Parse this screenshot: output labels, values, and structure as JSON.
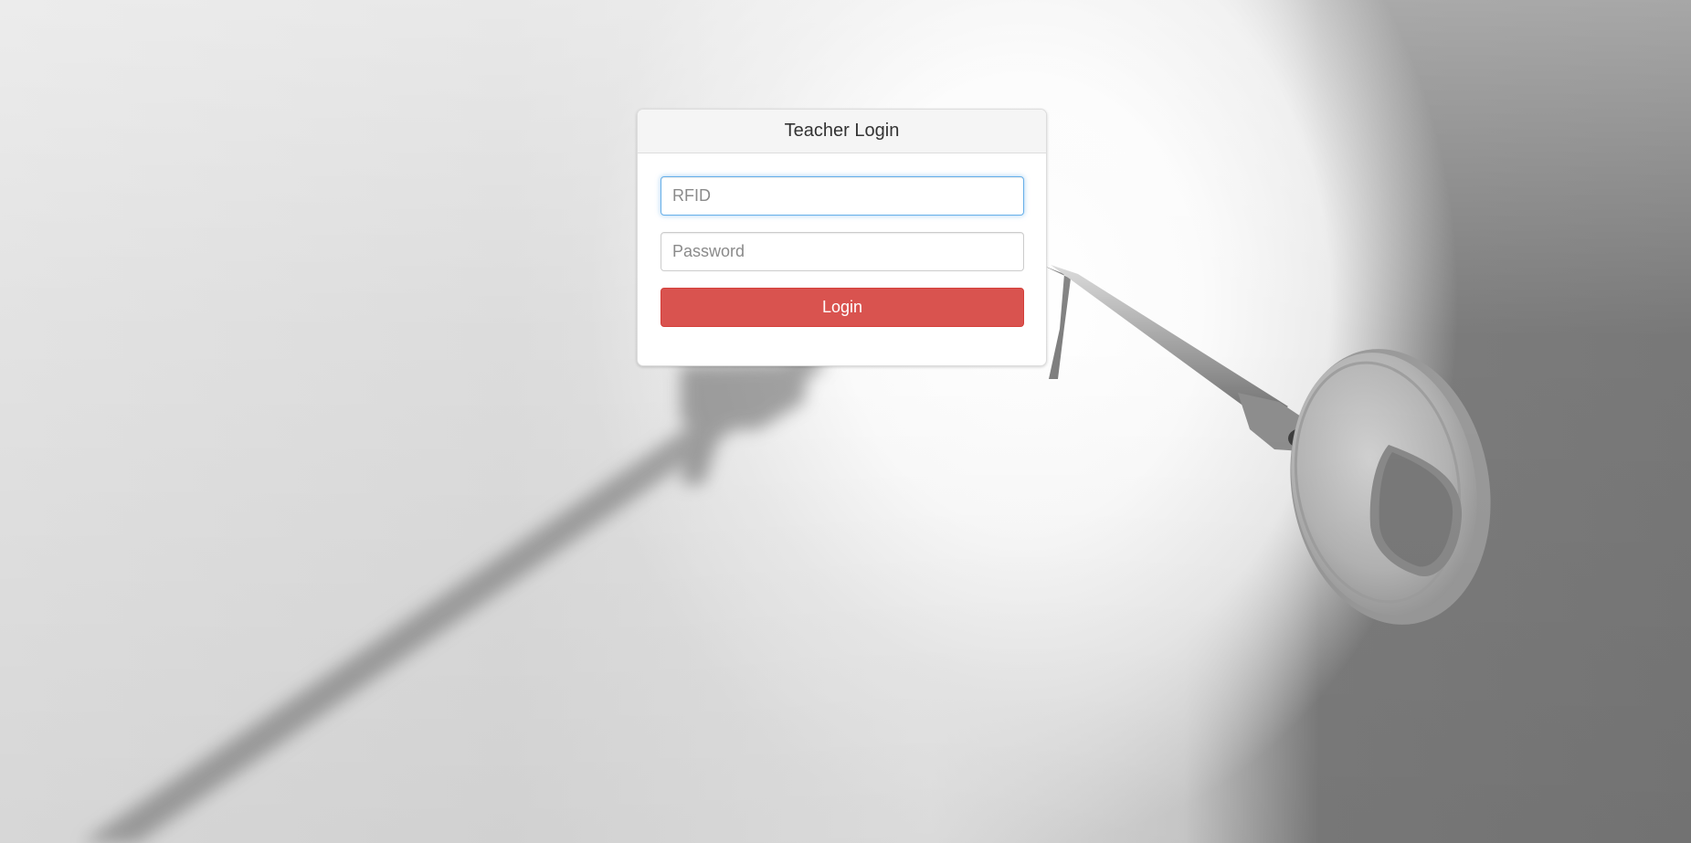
{
  "login_panel": {
    "title": "Teacher Login",
    "rfid_field": {
      "placeholder": "RFID",
      "value": ""
    },
    "password_field": {
      "placeholder": "Password",
      "value": ""
    },
    "login_button_label": "Login"
  },
  "background": {
    "image_subject": "key-in-lock-icon"
  },
  "colors": {
    "button": "#d9534f",
    "focus_border": "#66afe9",
    "panel_heading": "#f5f5f5"
  }
}
